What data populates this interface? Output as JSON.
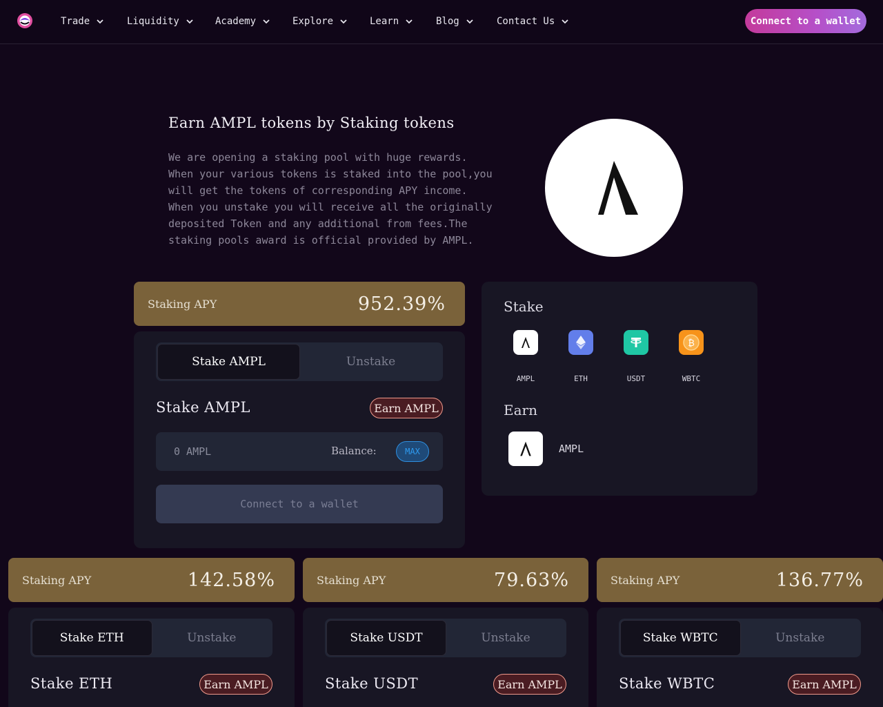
{
  "header": {
    "nav": [
      {
        "label": "Trade"
      },
      {
        "label": "Liquidity"
      },
      {
        "label": "Academy"
      },
      {
        "label": "Explore"
      },
      {
        "label": "Learn"
      },
      {
        "label": "Blog"
      },
      {
        "label": "Contact Us"
      }
    ],
    "connect_label": "Connect to a wallet"
  },
  "hero": {
    "title": "Earn AMPL tokens by Staking tokens",
    "description": "We are opening a staking pool with huge rewards. When your various tokens is staked into the pool,you will get the tokens of corresponding APY income. When you unstake you will receive all the originally deposited Token and any additional from fees.The staking pools award is official provided by AMPL.",
    "logo_glyph": "Λ"
  },
  "pools": [
    {
      "apy_label": "Staking APY",
      "apy_value": "952.39%",
      "tab_stake": "Stake AMPL",
      "tab_unstake": "Unstake",
      "title": "Stake AMPL",
      "earn_label": "Earn AMPL",
      "input_placeholder": "0 AMPL",
      "balance_label": "Balance:",
      "max_label": "MAX",
      "connect_label": "Connect to a wallet"
    },
    {
      "apy_label": "Staking APY",
      "apy_value": "142.58%",
      "tab_stake": "Stake ETH",
      "tab_unstake": "Unstake",
      "title": "Stake ETH",
      "earn_label": "Earn AMPL"
    },
    {
      "apy_label": "Staking APY",
      "apy_value": "79.63%",
      "tab_stake": "Stake USDT",
      "tab_unstake": "Unstake",
      "title": "Stake USDT",
      "earn_label": "Earn AMPL"
    },
    {
      "apy_label": "Staking APY",
      "apy_value": "136.77%",
      "tab_stake": "Stake WBTC",
      "tab_unstake": "Unstake",
      "title": "Stake WBTC",
      "earn_label": "Earn AMPL"
    }
  ],
  "panel": {
    "stake_title": "Stake",
    "tokens": [
      {
        "label": "AMPL",
        "icon": "ampl-icon",
        "glyph": "Λ",
        "color": "#ffffff"
      },
      {
        "label": "ETH",
        "icon": "eth-icon",
        "glyph": "◆",
        "color": "#627eea"
      },
      {
        "label": "USDT",
        "icon": "usdt-icon",
        "glyph": "₮",
        "color": "#26a17b"
      },
      {
        "label": "WBTC",
        "icon": "wbtc-icon",
        "glyph": "₿",
        "color": "#f7931a"
      }
    ],
    "earn_title": "Earn",
    "earn_token": {
      "label": "AMPL",
      "glyph": "Λ"
    }
  },
  "colors": {
    "background": "#12071a",
    "apy_bar": "#7a623a",
    "accent_gradient_start": "#c43a9b",
    "accent_gradient_end": "#a36bdd",
    "max_blue": "#2e9bf0"
  }
}
